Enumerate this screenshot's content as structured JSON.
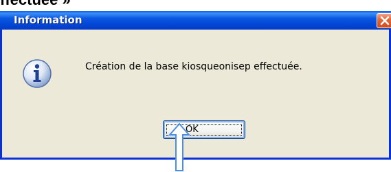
{
  "page": {
    "heading_fragment": "ffectuée »"
  },
  "dialog": {
    "title": "Information",
    "close_icon": "close-x-icon",
    "message_icon": "info-icon",
    "message": "Création de la base kiosqueonisep effectuée.",
    "ok_label": "OK",
    "colors": {
      "titlebar": "#0a57e0",
      "body": "#ece9d8",
      "close_button": "#e2683c",
      "arrow": "#4a90e2"
    }
  },
  "annotation": {
    "arrow_icon": "up-arrow-icon"
  }
}
